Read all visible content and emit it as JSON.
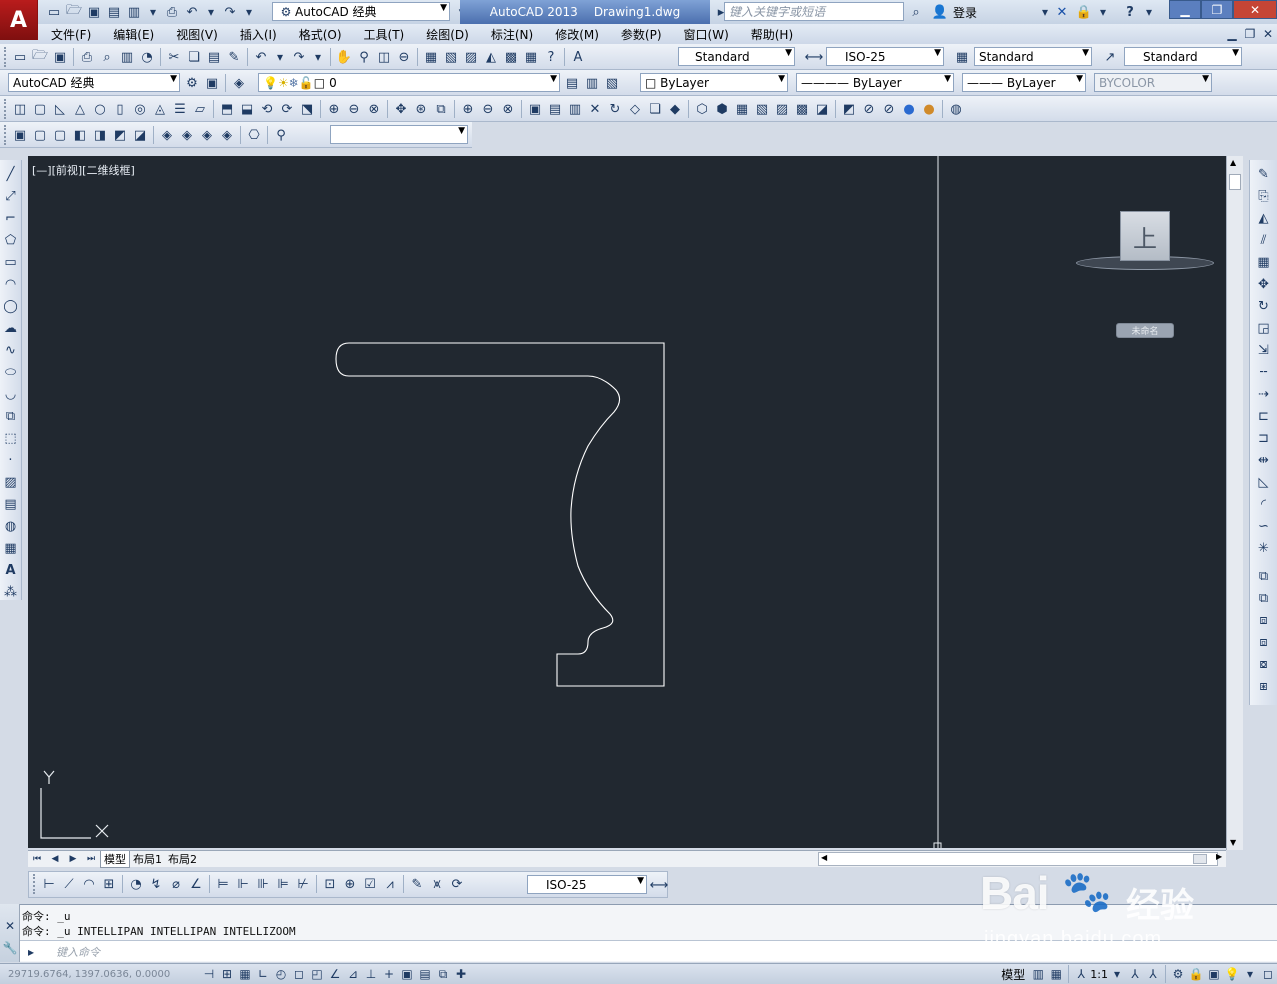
{
  "app": {
    "name": "AutoCAD 2013",
    "document": "Drawing1.dwg",
    "workspace": "AutoCAD 经典",
    "search_placeholder": "键入关键字或短语",
    "login": "登录"
  },
  "menu": [
    "文件(F)",
    "编辑(E)",
    "视图(V)",
    "插入(I)",
    "格式(O)",
    "工具(T)",
    "绘图(D)",
    "标注(N)",
    "修改(M)",
    "参数(P)",
    "窗口(W)",
    "帮助(H)"
  ],
  "styles": {
    "text_style": "Standard",
    "dim_style": "ISO-25",
    "table_style": "Standard",
    "multileader_style": "Standard"
  },
  "layers": {
    "workspace_combo": "AutoCAD 经典",
    "current_layer": "0",
    "color": "ByLayer",
    "linetype": "ByLayer",
    "lineweight": "ByLayer",
    "plotstyle": "BYCOLOR"
  },
  "viewport": {
    "label": "[—][前视][二维线框]",
    "viewcube_face": "上",
    "wcs_label": "未命名",
    "ucs_x": "X",
    "ucs_y": "Y",
    "colors": {
      "background": "#212830",
      "geometry": "#ffffff"
    }
  },
  "tabs": [
    "模型",
    "布局1",
    "布局2"
  ],
  "dim_toolbar": {
    "dim_style": "ISO-25"
  },
  "command": {
    "line1": "命令: _u",
    "line2": "命令: _u INTELLIPAN INTELLIPAN INTELLIZOOM",
    "prompt_placeholder": "键入命令"
  },
  "status": {
    "coords": "29719.6764, 1397.0636, 0.0000",
    "model": "模型",
    "annotation_scale": "1:1"
  },
  "watermark": {
    "brand": "Bai",
    "brand2": "经验",
    "url": "jingyan.baidu.com"
  }
}
